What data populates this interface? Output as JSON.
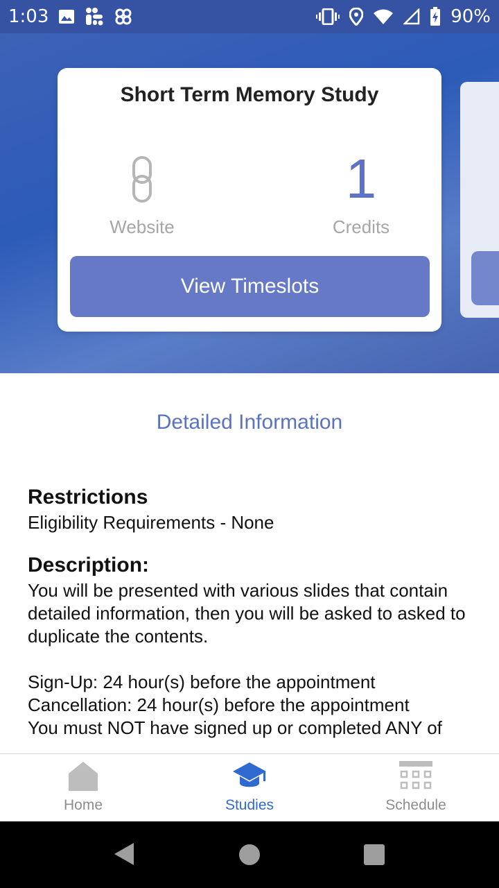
{
  "status_bar": {
    "time": "1:03",
    "battery": "90%",
    "icons_left": [
      "image-icon",
      "fit-app-icon",
      "pinwheel-icon"
    ],
    "icons_right": [
      "vibrate-icon",
      "location-icon",
      "wifi-icon",
      "signal-icon",
      "battery-icon"
    ]
  },
  "study_card": {
    "title": "Short Term Memory Study",
    "website_label": "Website",
    "credits_value": "1",
    "credits_label": "Credits",
    "button_label": "View Timeslots"
  },
  "detail": {
    "heading": "Detailed Information",
    "restrictions_title": "Restrictions",
    "restrictions_text": "Eligibility Requirements - None",
    "description_title": "Description:",
    "description_text": "You will be presented with various slides that contain detailed information, then you will be asked to asked to duplicate the contents.",
    "signup_text": "Sign-Up: 24 hour(s) before the appointment",
    "cancellation_text": "Cancellation: 24 hour(s) before the appointment",
    "prereq_text": "You must NOT have signed up or completed ANY of"
  },
  "bottom_nav": {
    "items": [
      {
        "label": "Home",
        "icon": "home-icon"
      },
      {
        "label": "Studies",
        "icon": "graduation-cap-icon"
      },
      {
        "label": "Schedule",
        "icon": "calendar-grid-icon"
      }
    ],
    "active_index": 1
  },
  "system_nav": [
    "back-icon",
    "home-circle-icon",
    "recents-icon"
  ],
  "colors": {
    "accent": "#6679c6",
    "active_nav": "#2f6ad0",
    "heading_blue": "#5a72c2",
    "status_bar": "#3553a2"
  }
}
